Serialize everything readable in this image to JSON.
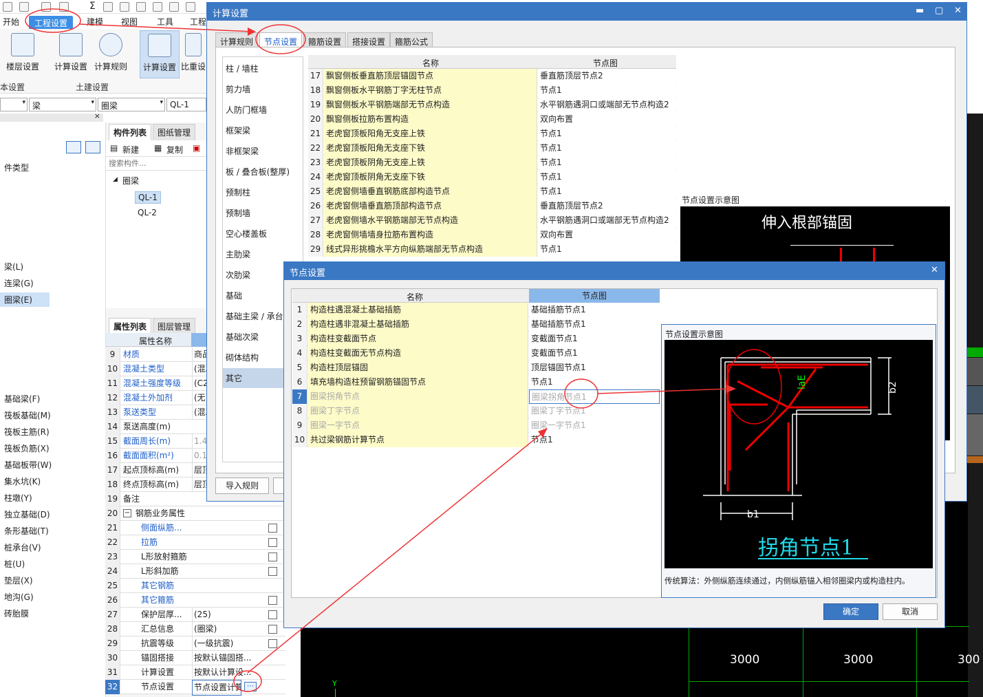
{
  "ribbon": {
    "tabs": [
      "开始",
      "工程设置",
      "建模",
      "视图",
      "工具",
      "工程"
    ],
    "buttons": [
      "楼层设置",
      "计算设置",
      "计算规则",
      "计算设置",
      "比重设"
    ],
    "groups": [
      "本设置",
      "土建设置"
    ]
  },
  "selectors": {
    "category": "梁",
    "type": "圈梁",
    "component": "QL-1"
  },
  "left_panel": {
    "header": "件类型",
    "items": [
      "梁(L)",
      "连梁(G)",
      "圈梁(E)"
    ],
    "items2": [
      "基础梁(F)",
      "筏板基础(M)",
      "筏板主筋(R)",
      "筏板负筋(X)",
      "基础板带(W)",
      "集水坑(K)",
      "柱墩(Y)",
      "独立基础(D)",
      "条形基础(T)",
      "桩承台(V)",
      "桩(U)",
      "垫层(X)",
      "地沟(G)",
      "砖胎膜"
    ]
  },
  "component_list": {
    "tabs": [
      "构件列表",
      "图纸管理"
    ],
    "new": "新建",
    "copy": "复制",
    "search_placeholder": "搜索构件...",
    "tree_root": "圈梁",
    "items": [
      "QL-1",
      "QL-2"
    ]
  },
  "property_list": {
    "tabs": [
      "属性列表",
      "图层管理"
    ],
    "header": "属性名称",
    "rows": [
      {
        "n": "9",
        "k": "材质",
        "v": "商品"
      },
      {
        "n": "10",
        "k": "混凝土类型",
        "v": "(混凝"
      },
      {
        "n": "11",
        "k": "混凝土强度等级",
        "v": "(C2"
      },
      {
        "n": "12",
        "k": "混凝土外加剂",
        "v": "(无)"
      },
      {
        "n": "13",
        "k": "泵送类型",
        "v": "(混凝"
      },
      {
        "n": "14",
        "k": "泵送高度(m)",
        "v": ""
      },
      {
        "n": "15",
        "k": "截面周长(m)",
        "v": "1.4"
      },
      {
        "n": "16",
        "k": "截面面积(m²)",
        "v": "0.1"
      },
      {
        "n": "17",
        "k": "起点顶标高(m)",
        "v": "层顶"
      },
      {
        "n": "18",
        "k": "终点顶标高(m)",
        "v": "层顶"
      },
      {
        "n": "19",
        "k": "备注",
        "v": ""
      },
      {
        "n": "20",
        "k": "钢筋业务属性",
        "v": ""
      },
      {
        "n": "21",
        "k": "侧面纵筋...",
        "v": ""
      },
      {
        "n": "22",
        "k": "拉筋",
        "v": ""
      },
      {
        "n": "23",
        "k": "L形放射箍筋",
        "v": ""
      },
      {
        "n": "24",
        "k": "L形斜加筋",
        "v": ""
      },
      {
        "n": "25",
        "k": "其它钢筋",
        "v": ""
      },
      {
        "n": "26",
        "k": "其它箍筋",
        "v": ""
      },
      {
        "n": "27",
        "k": "保护层厚...",
        "v": "(25)"
      },
      {
        "n": "28",
        "k": "汇总信息",
        "v": "(圈梁)"
      },
      {
        "n": "29",
        "k": "抗震等级",
        "v": "(一级抗震)"
      },
      {
        "n": "30",
        "k": "锚固搭接",
        "v": "按默认锚固搭..."
      },
      {
        "n": "31",
        "k": "计算设置",
        "v": "按默认计算设..."
      },
      {
        "n": "32",
        "k": "节点设置",
        "v": "节点设置计算"
      }
    ]
  },
  "calc_window": {
    "title": "计算设置",
    "tabs": [
      "计算规则",
      "节点设置",
      "箍筋设置",
      "搭接设置",
      "箍筋公式"
    ],
    "categories": [
      "柱 / 墙柱",
      "剪力墙",
      "人防门框墙",
      "框架梁",
      "非框架梁",
      "板 / 叠合板(整厚)",
      "预制柱",
      "预制墙",
      "空心楼盖板",
      "主肋梁",
      "次肋梁",
      "基础",
      "基础主梁 / 承台",
      "基础次梁",
      "砌体结构",
      "其它"
    ],
    "col_name": "名称",
    "col_node": "节点图",
    "rows": [
      {
        "n": "17",
        "k": "飘窗侧板垂直筋顶层锚固节点",
        "v": "垂直筋顶层节点2"
      },
      {
        "n": "18",
        "k": "飘窗侧板水平钢筋丁字无柱节点",
        "v": "节点1"
      },
      {
        "n": "19",
        "k": "飘窗侧板水平钢筋端部无节点构造",
        "v": "水平钢筋遇洞口或端部无节点构造2"
      },
      {
        "n": "20",
        "k": "飘窗侧板拉筋布置构造",
        "v": "双向布置"
      },
      {
        "n": "21",
        "k": "老虎窗顶板阳角无支座上铁",
        "v": "节点1"
      },
      {
        "n": "22",
        "k": "老虎窗顶板阳角无支座下铁",
        "v": "节点1"
      },
      {
        "n": "23",
        "k": "老虎窗顶板阴角无支座上铁",
        "v": "节点1"
      },
      {
        "n": "24",
        "k": "老虎窗顶板阴角无支座下铁",
        "v": "节点1"
      },
      {
        "n": "25",
        "k": "老虎窗侧墙垂直钢筋底部构造节点",
        "v": "节点1"
      },
      {
        "n": "26",
        "k": "老虎窗侧墙垂直筋顶部构造节点",
        "v": "垂直筋顶层节点2"
      },
      {
        "n": "27",
        "k": "老虎窗侧墙水平钢筋端部无节点构造",
        "v": "水平钢筋遇洞口或端部无节点构造2"
      },
      {
        "n": "28",
        "k": "老虎窗侧墙墙身拉筋布置构造",
        "v": "双向布置"
      },
      {
        "n": "29",
        "k": "线式异形挑檐水平方向纵筋端部无节点构造",
        "v": "节点1"
      }
    ],
    "preview_title": "节点设置示意图",
    "preview_caption": "伸入根部锚固",
    "import_button": "导入规则"
  },
  "node_window": {
    "title": "节点设置",
    "col_name": "名称",
    "col_node": "节点图",
    "rows": [
      {
        "n": "1",
        "k": "构造柱遇混凝土基础插筋",
        "v": "基础插筋节点1"
      },
      {
        "n": "2",
        "k": "构造柱遇非混凝土基础插筋",
        "v": "基础插筋节点1"
      },
      {
        "n": "3",
        "k": "构造柱变截面节点",
        "v": "变截面节点1"
      },
      {
        "n": "4",
        "k": "构造柱变截面无节点构造",
        "v": "变截面节点1"
      },
      {
        "n": "5",
        "k": "构造柱顶层锚固",
        "v": "顶层锚固节点1"
      },
      {
        "n": "6",
        "k": "填充墙构造柱预留钢筋锚固节点",
        "v": "节点1"
      },
      {
        "n": "7",
        "k": "圈梁拐角节点",
        "v": "圈梁拐角节点1"
      },
      {
        "n": "8",
        "k": "圈梁丁字节点",
        "v": "圈梁丁字节点1"
      },
      {
        "n": "9",
        "k": "圈梁一字节点",
        "v": "圈梁一字节点1"
      },
      {
        "n": "10",
        "k": "共过梁钢筋计算节点",
        "v": "节点1"
      }
    ],
    "preview_title": "节点设置示意图",
    "diagram_title": "拐角节点1",
    "label_lae": "laE",
    "label_b1": "b1",
    "label_b2": "b2",
    "description": "传统算法：外侧纵筋连续通过，内侧纵筋锚入相邻圈梁内或构造柱内。",
    "ok": "确定",
    "cancel": "取消"
  },
  "cad": {
    "dims": [
      "3000",
      "3000",
      "300"
    ],
    "axis": "Y"
  }
}
